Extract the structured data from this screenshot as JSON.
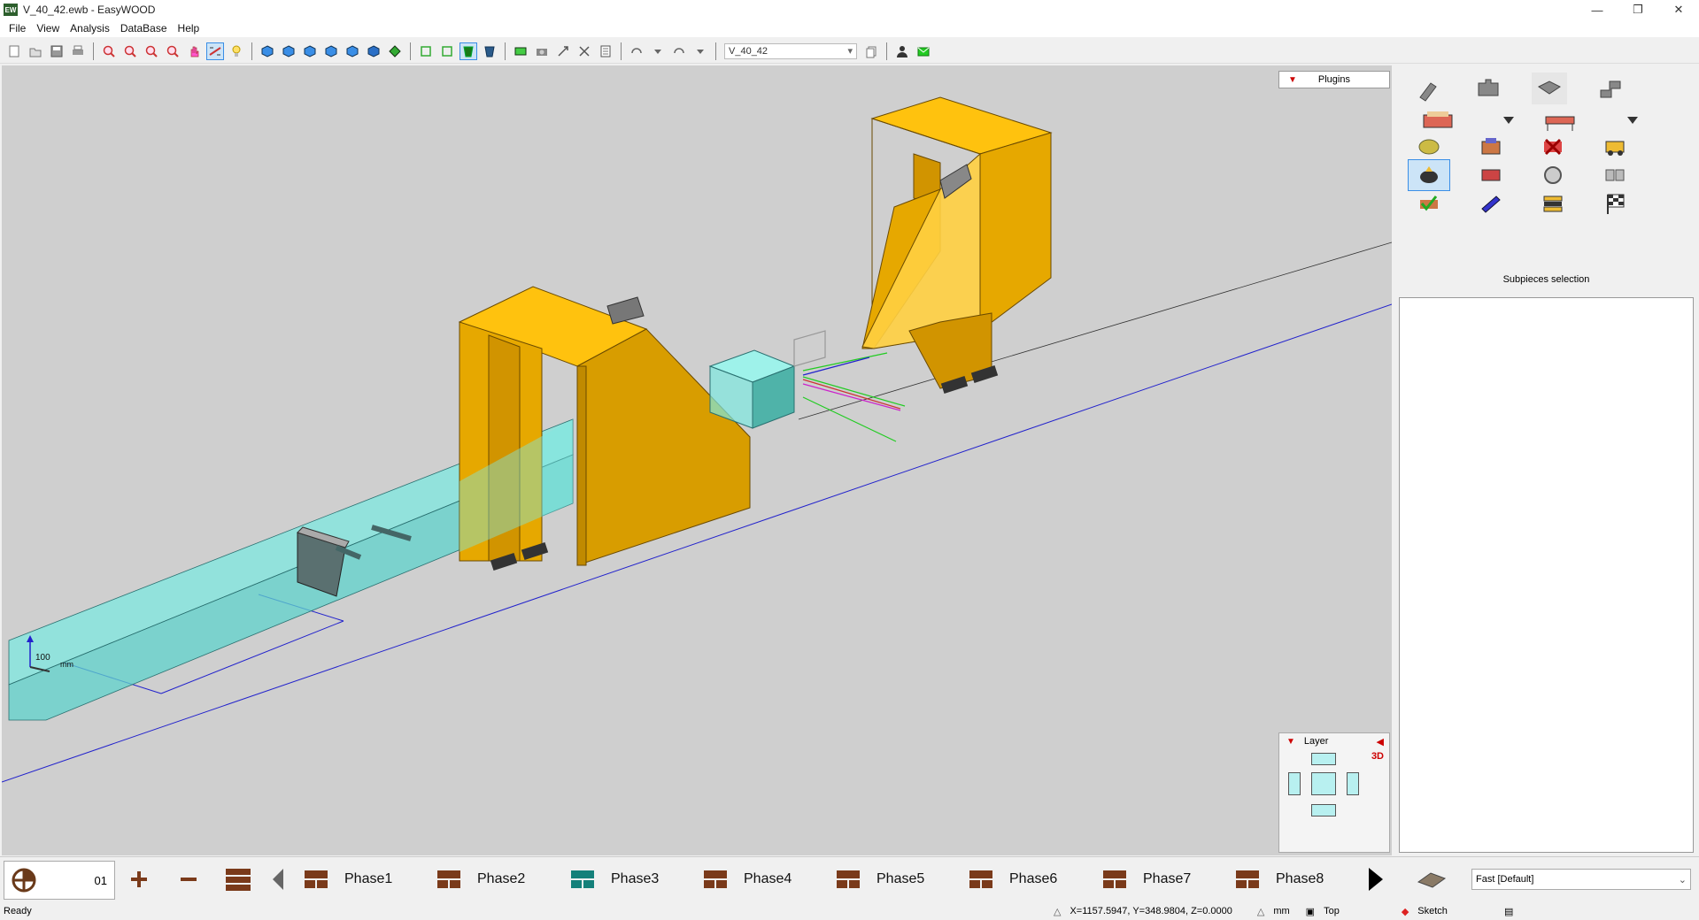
{
  "window": {
    "title": "V_40_42.ewb - EasyWOOD",
    "app_icon": "EW"
  },
  "menu": {
    "items": [
      "File",
      "View",
      "Analysis",
      "DataBase",
      "Help"
    ]
  },
  "toolbar": {
    "model_select": "V_40_42"
  },
  "viewport": {
    "plugins_label": "Plugins",
    "scale_label": "100",
    "scale_unit": "mm",
    "layer": {
      "title": "Layer",
      "mode": "3D"
    }
  },
  "right_panel": {
    "caption": "Subpieces selection"
  },
  "phasebar": {
    "counter": "01",
    "phases": [
      "Phase1",
      "Phase2",
      "Phase3",
      "Phase4",
      "Phase5",
      "Phase6",
      "Phase7",
      "Phase8"
    ],
    "active_phase": "Phase3",
    "quality": "Fast [Default]"
  },
  "status": {
    "ready": "Ready",
    "coords": "X=1157.5947, Y=348.9804, Z=0.0000",
    "unit": "mm",
    "view": "Top",
    "mode": "Sketch"
  },
  "colors": {
    "beam": "#e6a800",
    "beam_top": "#ffc20e",
    "glass": "#7de8e0",
    "viewport_bg": "#cfcfcf",
    "accent": "#3a8ee6"
  }
}
